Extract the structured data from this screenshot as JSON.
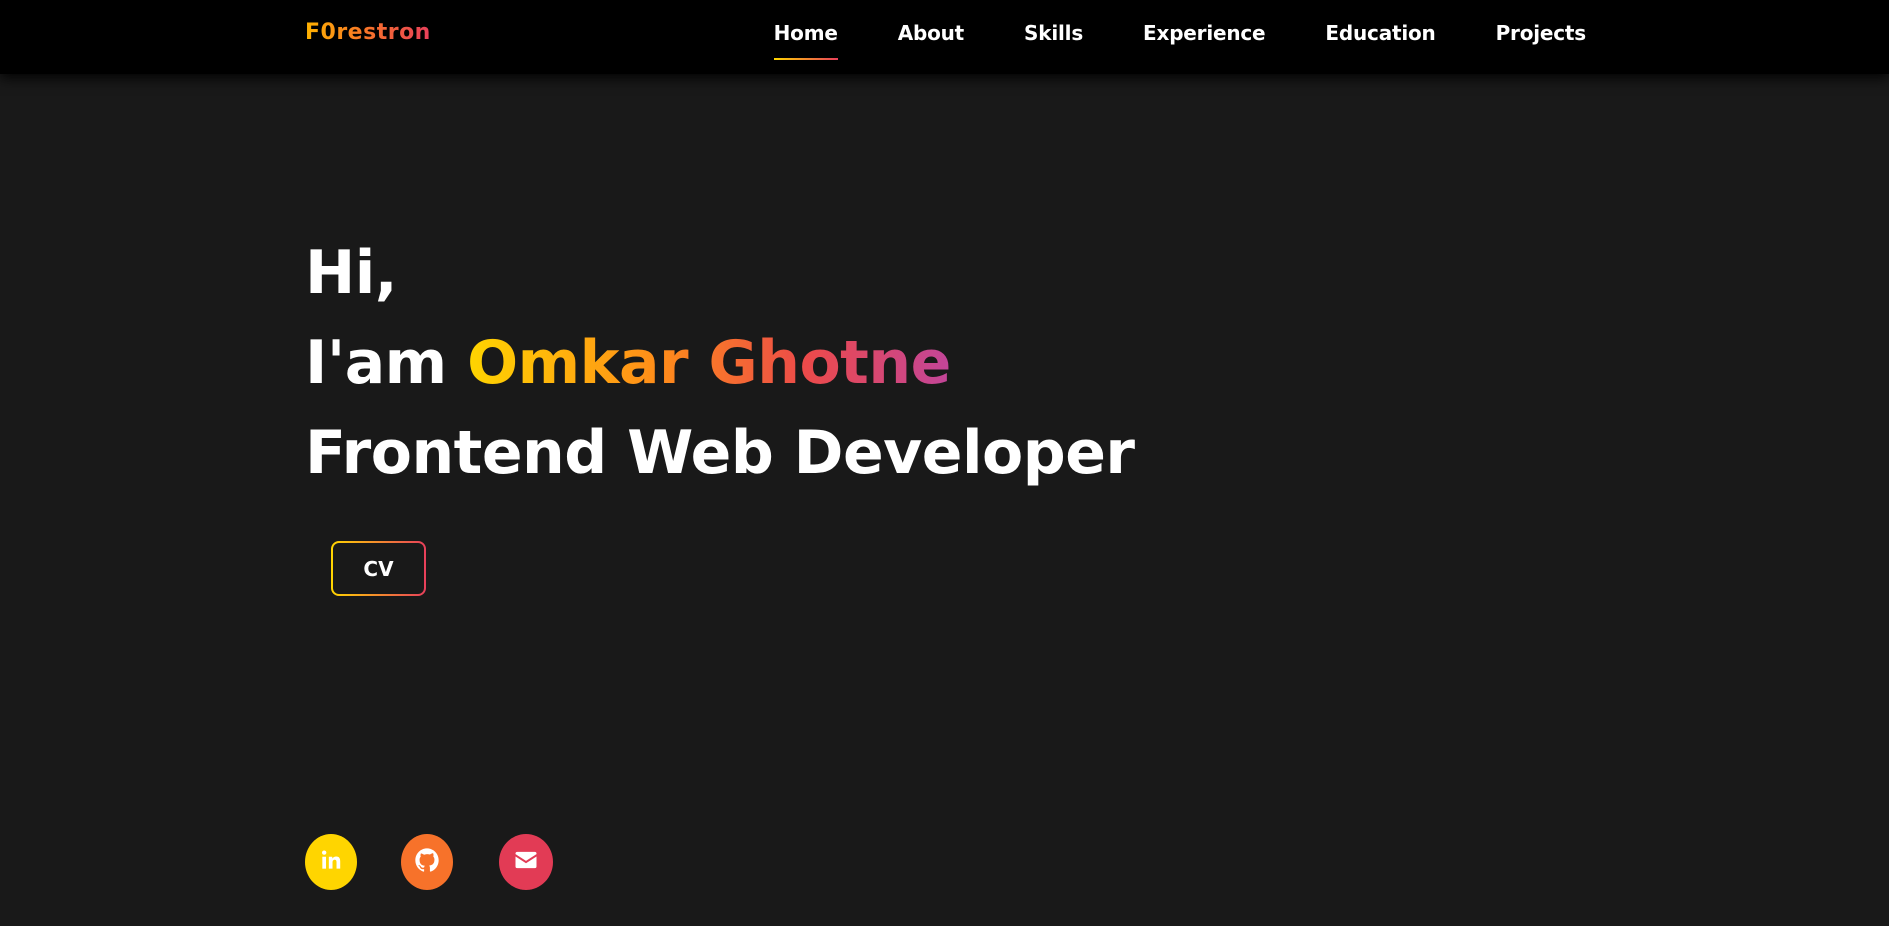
{
  "nav": {
    "logo": "F0restron",
    "links": [
      {
        "label": "Home",
        "active": true
      },
      {
        "label": "About"
      },
      {
        "label": "Skills"
      },
      {
        "label": "Experience"
      },
      {
        "label": "Education"
      },
      {
        "label": "Projects"
      }
    ]
  },
  "hero": {
    "greeting": "Hi,",
    "intro_prefix": "I'am",
    "name": "Omkar Ghotne",
    "role": "Frontend Web Developer"
  },
  "cv_button": {
    "label": "CV"
  },
  "socials": [
    {
      "icon": "linkedin-icon",
      "color": "#ffd500"
    },
    {
      "icon": "github-icon",
      "color": "#f7722a"
    },
    {
      "icon": "mail-icon",
      "color": "#e23b55"
    }
  ],
  "colors": {
    "background": "#191919",
    "navbar": "#000000",
    "gradient_start": "#ffd500",
    "gradient_end": "#e83f5b"
  }
}
